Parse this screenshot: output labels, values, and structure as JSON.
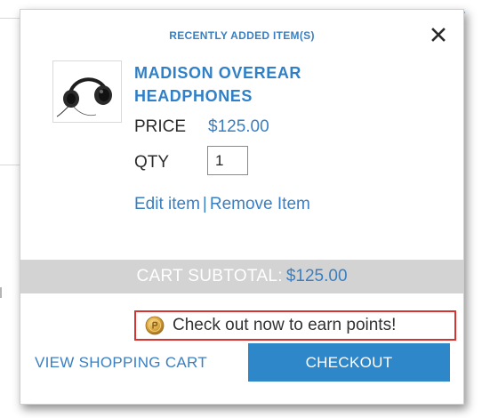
{
  "modal": {
    "title": "RECENTLY ADDED ITEM(S)",
    "close_icon": "close-icon"
  },
  "product": {
    "thumbnail_icon": "headphones-image",
    "name_line1": "MADISON OVEREAR",
    "name_line2": "HEADPHONES",
    "price_label": "PRICE",
    "price_value": "$125.00",
    "qty_label": "QTY",
    "qty_value": "1",
    "edit_label": "Edit item",
    "separator": "|",
    "remove_label": "Remove Item"
  },
  "subtotal": {
    "label": "CART SUBTOTAL:",
    "value": "$125.00"
  },
  "points": {
    "icon": "points-coin-icon",
    "text": "Check out now to earn points!"
  },
  "actions": {
    "view_cart_label": "VIEW SHOPPING CART",
    "checkout_label": "CHECKOUT"
  },
  "colors": {
    "accent_blue": "#2f80c8",
    "checkout_blue": "#2d87c8",
    "subtotal_bar": "#d3d3d3",
    "callout_border": "#d9332f"
  }
}
